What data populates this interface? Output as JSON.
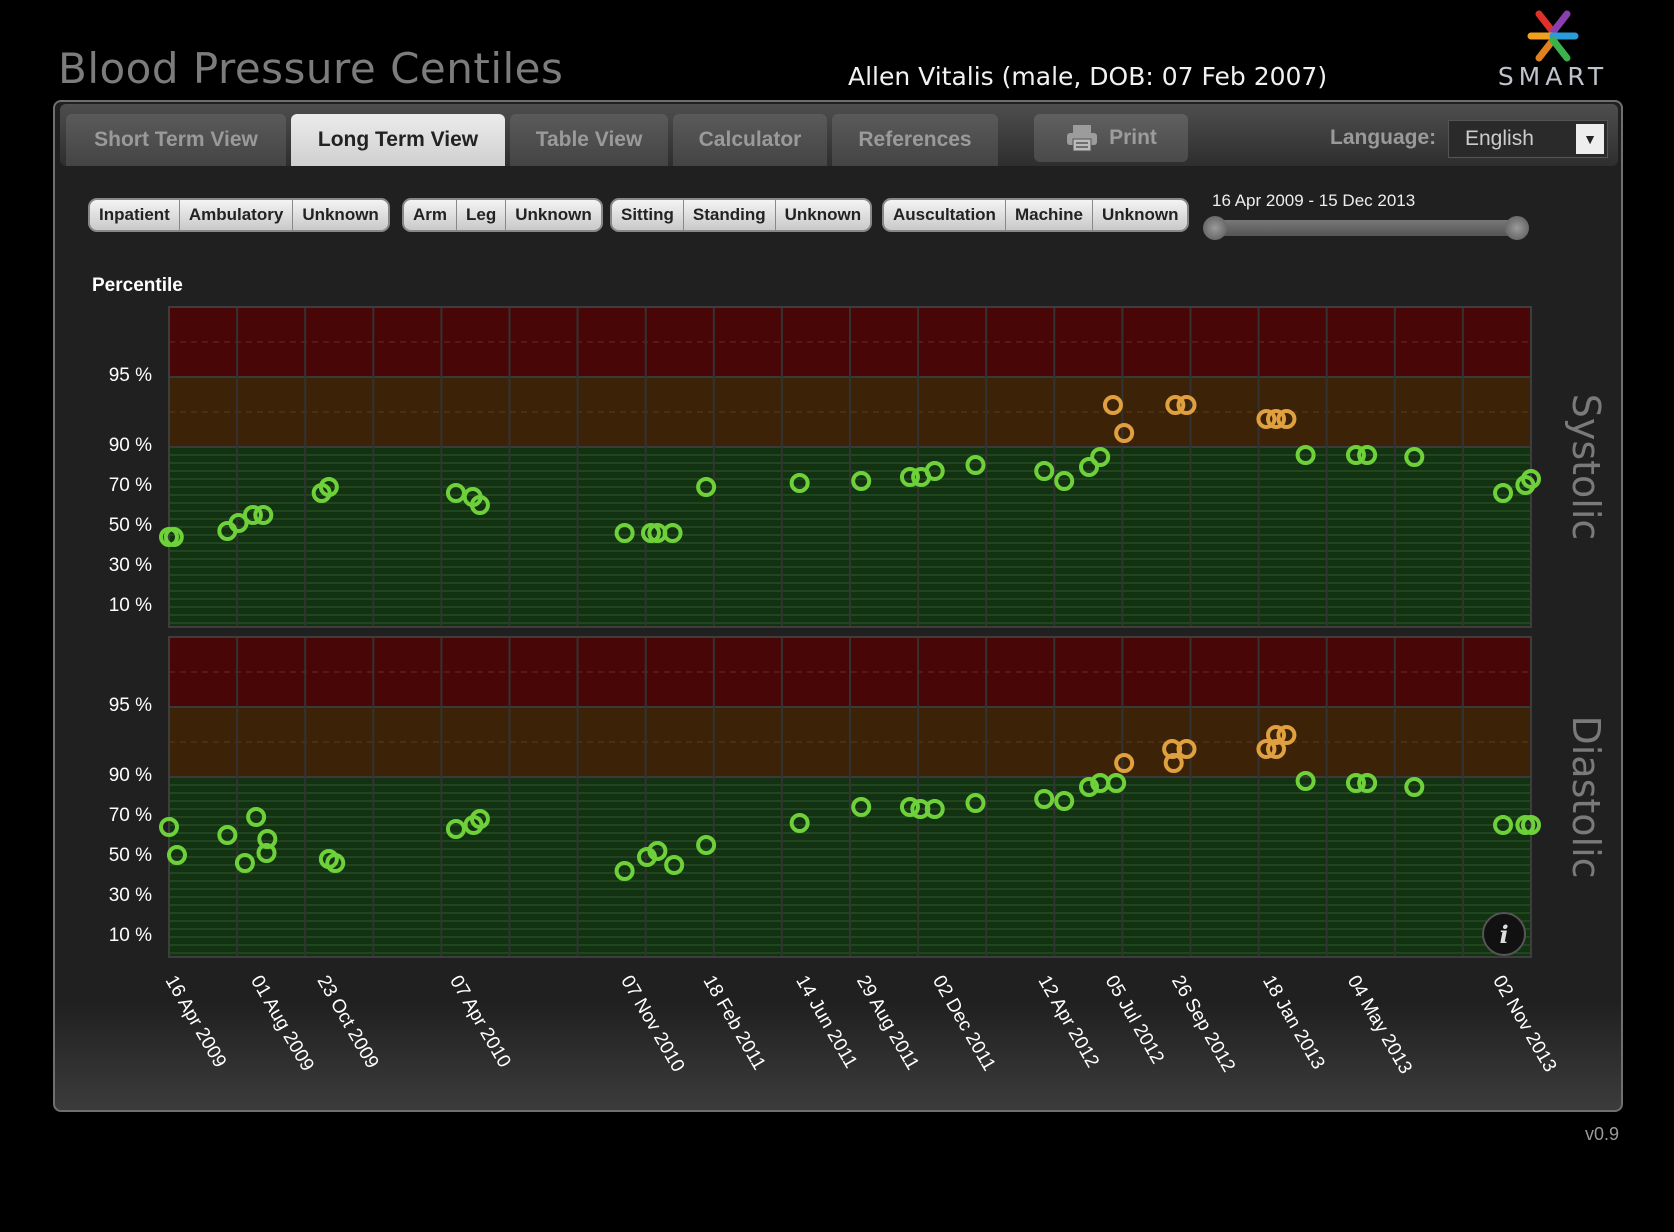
{
  "app": {
    "title": "Blood Pressure Centiles",
    "patient": "Allen Vitalis (male, DOB: 07 Feb 2007)",
    "version": "v0.9",
    "logo_text": "SMART"
  },
  "tabs": [
    {
      "label": "Short Term View",
      "active": false
    },
    {
      "label": "Long Term View",
      "active": true
    },
    {
      "label": "Table View",
      "active": false
    },
    {
      "label": "Calculator",
      "active": false
    },
    {
      "label": "References",
      "active": false
    }
  ],
  "toolbar": {
    "print_label": "Print",
    "language_label": "Language:",
    "language_value": "English"
  },
  "filters": [
    [
      "Inpatient",
      "Ambulatory",
      "Unknown"
    ],
    [
      "Arm",
      "Leg",
      "Unknown"
    ],
    [
      "Sitting",
      "Standing",
      "Unknown"
    ],
    [
      "Auscultation",
      "Machine",
      "Unknown"
    ]
  ],
  "date_range": {
    "label": "16 Apr 2009 - 15 Dec 2013"
  },
  "chart_data": {
    "type": "scatter",
    "ylabel": "Percentile",
    "ytick_labels": [
      "95 %",
      "90 %",
      "70 %",
      "50 %",
      "30 %",
      "10 %"
    ],
    "xtick_labels": [
      "16 Apr 2009",
      "01 Aug 2009",
      "23 Oct 2009",
      "07 Apr 2010",
      "07 Nov 2010",
      "18 Feb 2011",
      "14 Jun 2011",
      "29 Aug 2011",
      "02 Dec 2011",
      "12 Apr 2012",
      "05 Jul 2012",
      "26 Sep 2012",
      "18 Jan 2013",
      "04 May 2013",
      "02 Nov 2013"
    ],
    "x_range": [
      "2009-04-16",
      "2013-12-15"
    ],
    "colors": {
      "normal": "#6fd13a",
      "prehypertension": "#e0a040",
      "zone_red": "#480606",
      "zone_orange": "#3c2206",
      "zone_green": "#123212"
    },
    "panels": [
      {
        "name": "Systolic",
        "points": [
          [
            "2009-04-16",
            45
          ],
          [
            "2009-04-22",
            45
          ],
          [
            "2009-06-28",
            48
          ],
          [
            "2009-07-12",
            52
          ],
          [
            "2009-07-30",
            56
          ],
          [
            "2009-08-12",
            56
          ],
          [
            "2009-10-24",
            67
          ],
          [
            "2009-11-02",
            70
          ],
          [
            "2010-04-10",
            67
          ],
          [
            "2010-05-01",
            65
          ],
          [
            "2010-05-10",
            61
          ],
          [
            "2010-11-07",
            47
          ],
          [
            "2010-12-10",
            47
          ],
          [
            "2010-12-18",
            47
          ],
          [
            "2011-01-06",
            47
          ],
          [
            "2011-02-17",
            70
          ],
          [
            "2011-06-14",
            72
          ],
          [
            "2011-08-30",
            73
          ],
          [
            "2011-10-30",
            75
          ],
          [
            "2011-11-13",
            75
          ],
          [
            "2011-11-30",
            78
          ],
          [
            "2012-01-20",
            81
          ],
          [
            "2012-04-15",
            78
          ],
          [
            "2012-05-10",
            73
          ],
          [
            "2012-06-10",
            80
          ],
          [
            "2012-06-24",
            85
          ],
          [
            "2012-07-10",
            93
          ],
          [
            "2012-07-24",
            91
          ],
          [
            "2012-09-26",
            93
          ],
          [
            "2012-10-10",
            93
          ],
          [
            "2013-01-18",
            92
          ],
          [
            "2013-01-30",
            92
          ],
          [
            "2013-02-12",
            92
          ],
          [
            "2013-03-08",
            86
          ],
          [
            "2013-05-10",
            86
          ],
          [
            "2013-05-24",
            86
          ],
          [
            "2013-07-22",
            85
          ],
          [
            "2013-11-10",
            67
          ],
          [
            "2013-12-08",
            71
          ],
          [
            "2013-12-15",
            74
          ]
        ]
      },
      {
        "name": "Diastolic",
        "points": [
          [
            "2009-04-16",
            65
          ],
          [
            "2009-04-26",
            51
          ],
          [
            "2009-06-28",
            61
          ],
          [
            "2009-07-20",
            47
          ],
          [
            "2009-08-03",
            70
          ],
          [
            "2009-08-17",
            59
          ],
          [
            "2009-08-16",
            52
          ],
          [
            "2009-11-02",
            49
          ],
          [
            "2009-11-10",
            47
          ],
          [
            "2010-04-10",
            64
          ],
          [
            "2010-05-02",
            66
          ],
          [
            "2010-05-10",
            69
          ],
          [
            "2010-11-07",
            43
          ],
          [
            "2010-12-05",
            50
          ],
          [
            "2010-12-18",
            53
          ],
          [
            "2011-01-08",
            46
          ],
          [
            "2011-02-17",
            56
          ],
          [
            "2011-06-14",
            67
          ],
          [
            "2011-08-30",
            75
          ],
          [
            "2011-10-30",
            75
          ],
          [
            "2011-11-12",
            74
          ],
          [
            "2011-11-30",
            74
          ],
          [
            "2012-01-20",
            77
          ],
          [
            "2012-04-15",
            79
          ],
          [
            "2012-05-10",
            78
          ],
          [
            "2012-06-10",
            85
          ],
          [
            "2012-06-24",
            87
          ],
          [
            "2012-07-14",
            87
          ],
          [
            "2012-07-24",
            91
          ],
          [
            "2012-09-22",
            92
          ],
          [
            "2012-09-24",
            91
          ],
          [
            "2012-10-10",
            92
          ],
          [
            "2013-01-18",
            92
          ],
          [
            "2013-01-30",
            92
          ],
          [
            "2013-02-12",
            93
          ],
          [
            "2013-01-30",
            93
          ],
          [
            "2013-03-08",
            88
          ],
          [
            "2013-05-10",
            87
          ],
          [
            "2013-05-24",
            87
          ],
          [
            "2013-07-22",
            85
          ],
          [
            "2013-11-10",
            66
          ],
          [
            "2013-12-08",
            66
          ],
          [
            "2013-12-15",
            66
          ]
        ]
      }
    ]
  }
}
